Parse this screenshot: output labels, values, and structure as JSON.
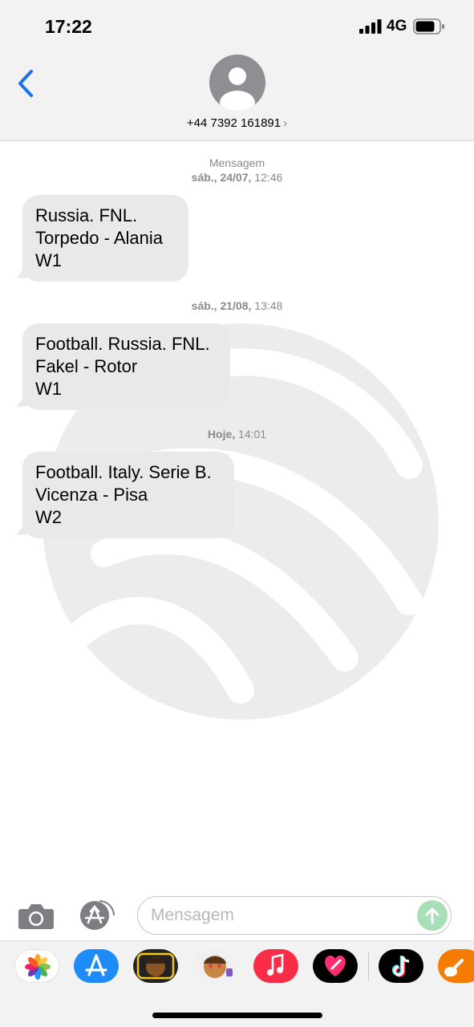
{
  "status_bar": {
    "time": "17:22",
    "network": "4G"
  },
  "header": {
    "contact": "+44 7392 161891",
    "chevron": "›"
  },
  "messages": [
    {
      "stamp_label": "Mensagem",
      "stamp_date": "sáb., 24/07,",
      "stamp_time": "12:46",
      "lines": [
        "Russia. FNL.",
        "Torpedo - Alania",
        "W1"
      ]
    },
    {
      "stamp_label": "",
      "stamp_date": "sáb., 21/08,",
      "stamp_time": "13:48",
      "lines": [
        "Football. Russia. FNL.",
        "Fakel - Rotor",
        "W1"
      ]
    },
    {
      "stamp_label": "",
      "stamp_date": "Hoje,",
      "stamp_time": "14:01",
      "lines": [
        "Football. Italy. Serie B.",
        "Vicenza - Pisa",
        "W2"
      ]
    }
  ],
  "input": {
    "placeholder": "Mensagem",
    "value": ""
  },
  "colors": {
    "accent": "#1a73e8",
    "bubble": "#e9e9eb",
    "header_bg": "#f2f2f3",
    "send_disabled": "#a9dfb8",
    "timestamp": "#8a8a8f"
  },
  "app_drawer": {
    "icons": [
      "photos-icon",
      "app-store-icon",
      "memoji-icon",
      "memoji-stickers-icon",
      "music-icon",
      "digital-touch-icon",
      "tiktok-icon",
      "garageband-icon"
    ]
  }
}
